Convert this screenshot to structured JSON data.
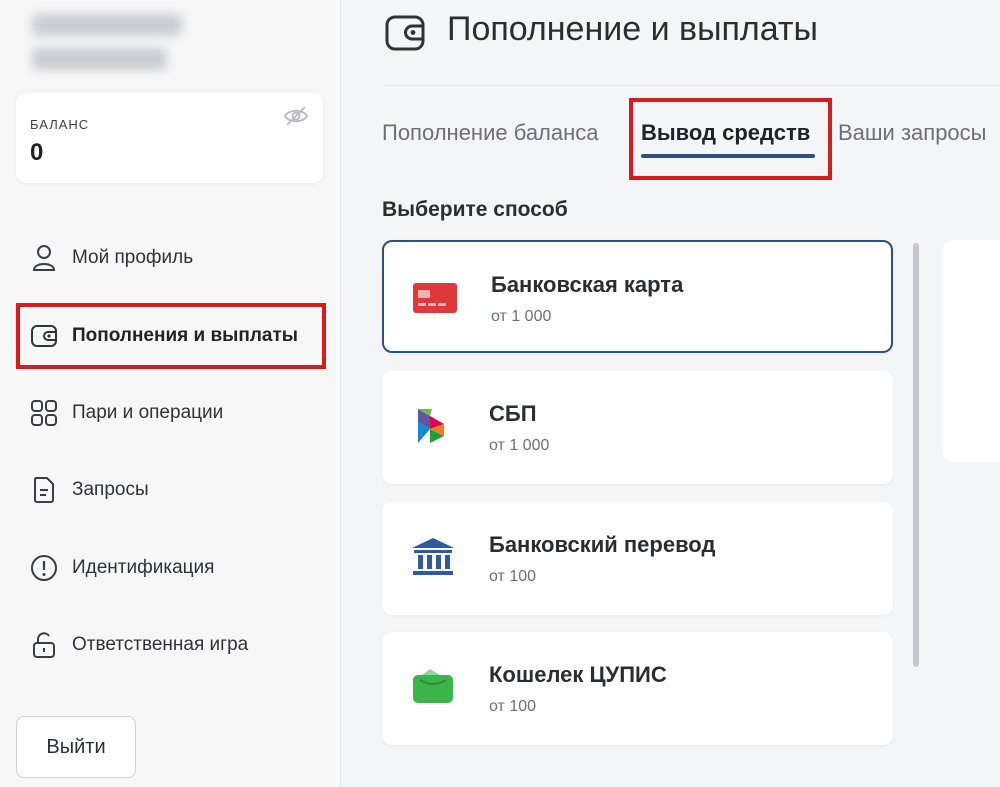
{
  "sidebar": {
    "balance_label": "БАЛАНС",
    "balance_value": "0",
    "nav": [
      {
        "label": "Мой профиль",
        "icon": "user-icon"
      },
      {
        "label": "Пополнения и выплаты",
        "icon": "wallet-icon"
      },
      {
        "label": "Пари и операции",
        "icon": "grid-icon"
      },
      {
        "label": "Запросы",
        "icon": "document-icon"
      },
      {
        "label": "Идентификация",
        "icon": "alert-circle-icon"
      },
      {
        "label": "Ответственная игра",
        "icon": "lock-icon"
      }
    ],
    "logout_label": "Выйти"
  },
  "main": {
    "title": "Пополнение и выплаты",
    "tabs": [
      {
        "label": "Пополнение баланса"
      },
      {
        "label": "Вывод средств"
      },
      {
        "label": "Ваши запросы"
      }
    ],
    "section_label": "Выберите способ",
    "methods": [
      {
        "title": "Банковская карта",
        "min": "от 1 000",
        "icon": "bank-card-icon"
      },
      {
        "title": "СБП",
        "min": "от 1 000",
        "icon": "sbp-logo-icon"
      },
      {
        "title": "Банковский перевод",
        "min": "от 100",
        "icon": "bank-building-icon"
      },
      {
        "title": "Кошелек ЦУПИС",
        "min": "от 100",
        "icon": "cupis-wallet-icon"
      }
    ]
  },
  "colors": {
    "accent": "#2f4f83",
    "highlight": "#d81b1b",
    "card_red": "#e0393b",
    "wallet_green": "#3bb54a"
  }
}
